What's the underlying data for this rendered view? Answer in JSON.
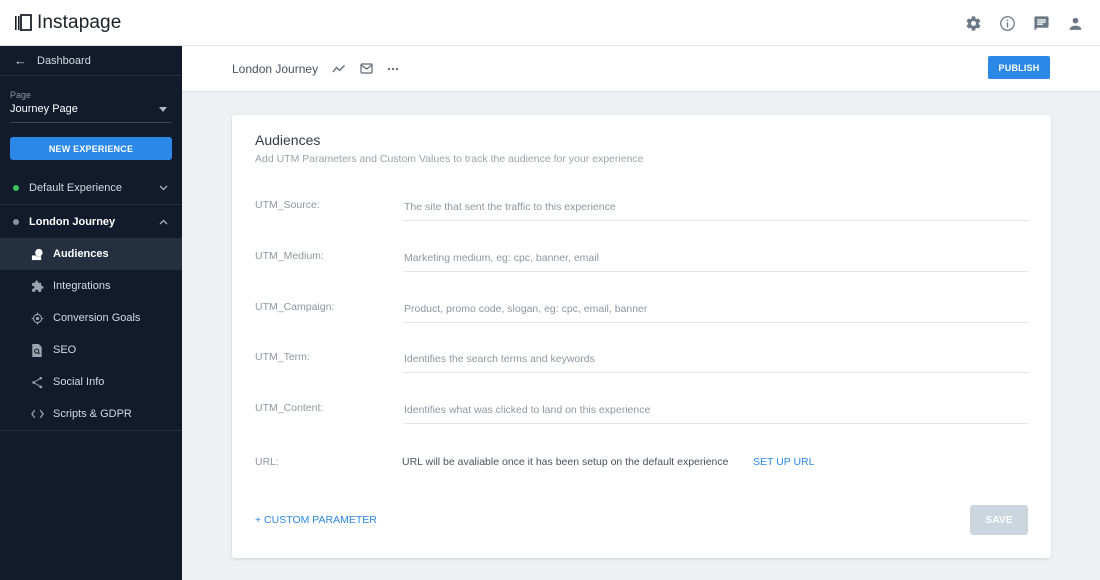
{
  "app": {
    "brand": "Instapage",
    "top_icons": [
      "gear-icon",
      "info-icon",
      "chat-icon",
      "user-icon"
    ]
  },
  "sidebar": {
    "back_label": "Dashboard",
    "page_label": "Page",
    "page_value": "Journey Page",
    "new_experience_label": "NEW EXPERIENCE",
    "experiences": [
      {
        "label": "Default Experience",
        "status_color": "#3fbf5a",
        "expanded": false
      },
      {
        "label": "London Journey",
        "status_color": "#8a929c",
        "expanded": true
      }
    ],
    "items": [
      {
        "label": "Audiences",
        "icon": "audiences-icon",
        "active": true
      },
      {
        "label": "Integrations",
        "icon": "puzzle-icon",
        "active": false
      },
      {
        "label": "Conversion Goals",
        "icon": "target-icon",
        "active": false
      },
      {
        "label": "SEO",
        "icon": "seo-icon",
        "active": false
      },
      {
        "label": "Social Info",
        "icon": "share-icon",
        "active": false
      },
      {
        "label": "Scripts & GDPR",
        "icon": "code-icon",
        "active": false
      }
    ]
  },
  "subheader": {
    "title": "London Journey",
    "publish_label": "PUBLISH"
  },
  "card": {
    "title": "Audiences",
    "subtitle": "Add UTM Parameters and Custom Values to track the audience for your experience",
    "fields": [
      {
        "label": "UTM_Source:",
        "value": "",
        "placeholder": "The site that sent the traffic to this experience"
      },
      {
        "label": "UTM_Medium:",
        "value": "",
        "placeholder": "Marketing medium, eg: cpc, banner, email"
      },
      {
        "label": "UTM_Campaign:",
        "value": "",
        "placeholder": "Product, promo code, slogan, eg: cpc, email, banner"
      },
      {
        "label": "UTM_Term:",
        "value": "",
        "placeholder": "Identifies the search terms and keywords"
      },
      {
        "label": "UTM_Content:",
        "value": "",
        "placeholder": "Identifies what was clicked to land on this experience"
      }
    ],
    "url_label": "URL:",
    "url_text": "URL will be avaliable once it has been setup on the default experience",
    "url_link": "SET UP URL",
    "custom_param_label": "+ CUSTOM PARAMETER",
    "save_label": "SAVE"
  },
  "colors": {
    "accent": "#2b88e6",
    "sidebar_bg": "#111b2b",
    "save_disabled": "#ccd6df"
  }
}
